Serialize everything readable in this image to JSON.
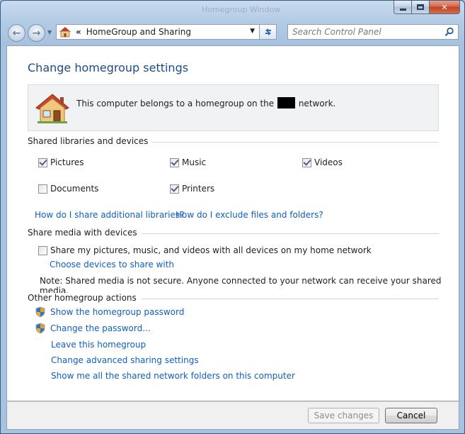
{
  "window": {
    "ghost_title": "Homegroup Window",
    "minimize": "min",
    "maximize": "max",
    "close": "✕"
  },
  "nav": {
    "back_icon": "back-arrow-icon",
    "forward_icon": "forward-arrow-icon"
  },
  "address": {
    "separator": "«",
    "crumb": "HomeGroup and Sharing"
  },
  "search": {
    "placeholder": "Search Control Panel"
  },
  "page": {
    "title": "Change homegroup settings",
    "info_before": "This computer belongs to a homegroup on the",
    "info_after": "network."
  },
  "shared": {
    "heading": "Shared libraries and devices",
    "items": [
      {
        "label": "Pictures",
        "checked": true
      },
      {
        "label": "Music",
        "checked": true
      },
      {
        "label": "Videos",
        "checked": true
      },
      {
        "label": "Documents",
        "checked": false
      },
      {
        "label": "Printers",
        "checked": true
      }
    ],
    "link_libraries": "How do I share additional libraries?",
    "link_exclude": "How do I exclude files and folders?"
  },
  "media": {
    "heading": "Share media with devices",
    "checkbox_label": "Share my pictures, music, and videos with all devices on my home network",
    "checked": false,
    "choose_link": "Choose devices to share with",
    "note": "Note: Shared media is not secure. Anyone connected to your network can receive your shared media."
  },
  "actions": {
    "heading": "Other homegroup actions",
    "show_password": "Show the homegroup password",
    "change_password": "Change the password...",
    "leave": "Leave this homegroup",
    "advanced": "Change advanced sharing settings",
    "show_folders": "Show me all the shared network folders on this computer"
  },
  "footer": {
    "save": "Save changes",
    "cancel": "Cancel"
  }
}
